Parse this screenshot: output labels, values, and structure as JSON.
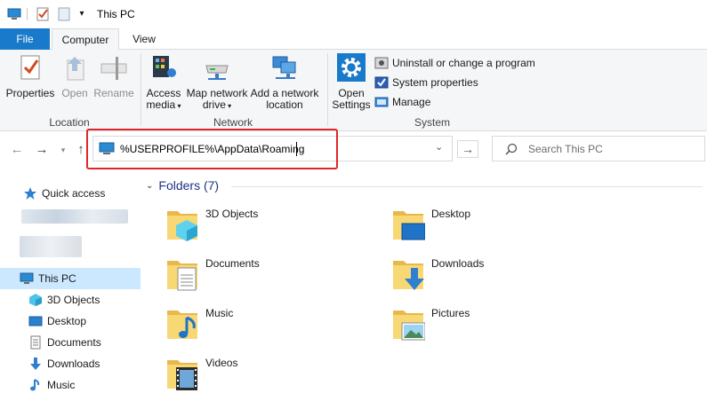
{
  "window": {
    "title": "This PC"
  },
  "tabs": {
    "file": "File",
    "computer": "Computer",
    "view": "View"
  },
  "ribbon": {
    "location": {
      "label": "Location",
      "properties": "Properties",
      "open": "Open",
      "rename": "Rename"
    },
    "network": {
      "label": "Network",
      "access_media_line1": "Access",
      "access_media_line2": "media",
      "map_drive_line1": "Map network",
      "map_drive_line2": "drive",
      "add_location_line1": "Add a network",
      "add_location_line2": "location"
    },
    "system": {
      "label": "System",
      "open_settings_line1": "Open",
      "open_settings_line2": "Settings",
      "uninstall": "Uninstall or change a program",
      "system_properties": "System properties",
      "manage": "Manage"
    }
  },
  "address": {
    "value": "%USERPROFILE%\\AppData\\Roaming"
  },
  "search": {
    "placeholder": "Search This PC"
  },
  "nav_pane": {
    "quick_access": "Quick access",
    "this_pc": "This PC",
    "items": [
      "3D Objects",
      "Desktop",
      "Documents",
      "Downloads",
      "Music"
    ]
  },
  "content": {
    "group_header": "Folders (7)",
    "folders": [
      "3D Objects",
      "Desktop",
      "Documents",
      "Downloads",
      "Music",
      "Pictures",
      "Videos"
    ]
  },
  "colors": {
    "accent": "#1979ca",
    "highlight_box": "#e0262b",
    "folder_yellow": "#f8d775",
    "selection": "#cce8ff"
  }
}
